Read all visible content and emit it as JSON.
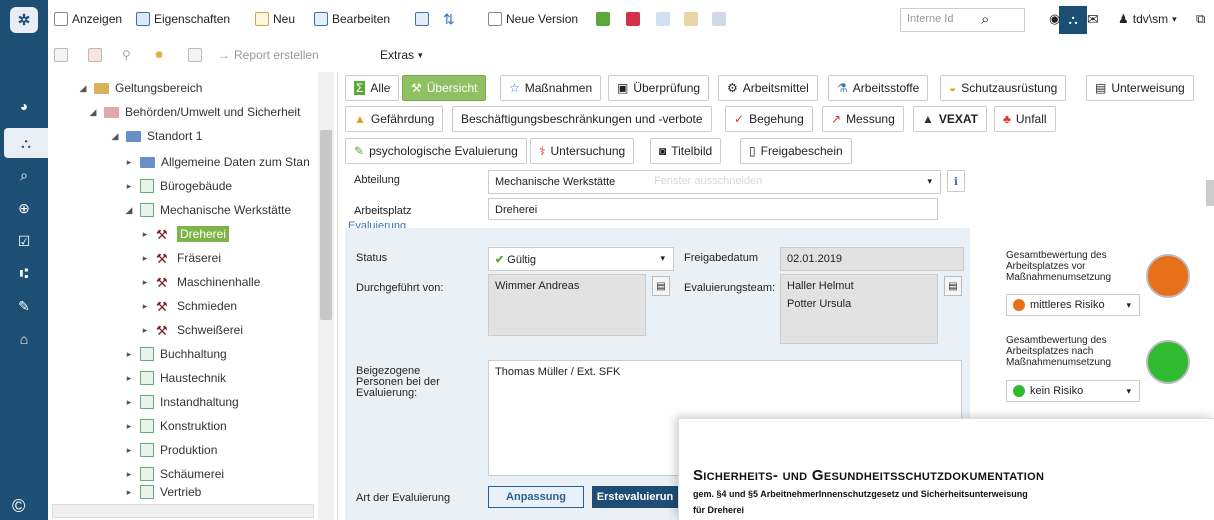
{
  "toolbar": {
    "anzeigen": "Anzeigen",
    "eigenschaften": "Eigenschaften",
    "neu": "Neu",
    "bearbeiten": "Bearbeiten",
    "neue_version": "Neue Version",
    "id_placeholder": "Interne Id",
    "user": "tdv\\sm",
    "report": "Report erstellen",
    "extras": "Extras"
  },
  "tree": [
    {
      "label": "Geltungsbereich"
    },
    {
      "label": "Behörden/Umwelt und Sicherheit"
    },
    {
      "label": "Standort 1"
    },
    {
      "label": "Allgemeine Daten zum Stan"
    },
    {
      "label": "Bürogebäude"
    },
    {
      "label": "Mechanische Werkstätte"
    },
    {
      "label": "Dreherei"
    },
    {
      "label": "Fräserei"
    },
    {
      "label": "Maschinenhalle"
    },
    {
      "label": "Schmieden"
    },
    {
      "label": "Schweißerei"
    },
    {
      "label": "Buchhaltung"
    },
    {
      "label": "Haustechnik"
    },
    {
      "label": "Instandhaltung"
    },
    {
      "label": "Konstruktion"
    },
    {
      "label": "Produktion"
    },
    {
      "label": "Schäumerei"
    },
    {
      "label": "Vertrieb"
    }
  ],
  "tabs": [
    {
      "label": "Alle"
    },
    {
      "label": "Übersicht"
    },
    {
      "label": "Maßnahmen"
    },
    {
      "label": "Überprüfung"
    },
    {
      "label": "Arbeitsmittel"
    },
    {
      "label": "Arbeitsstoffe"
    },
    {
      "label": "Schutzausrüstung"
    },
    {
      "label": "Unterweisung"
    },
    {
      "label": "Gefährdung"
    },
    {
      "label": "Beschäftigungsbeschränkungen und -verbote"
    },
    {
      "label": "Begehung"
    },
    {
      "label": "Messung"
    },
    {
      "label": "VEXAT"
    },
    {
      "label": "Unfall"
    },
    {
      "label": "psychologische Evaluierung"
    },
    {
      "label": "Untersuchung"
    },
    {
      "label": "Titelbild"
    },
    {
      "label": "Freigabeschein"
    }
  ],
  "form": {
    "abteilung_label": "Abteilung",
    "abteilung_value": "Mechanische Werkstätte",
    "abteilung_ghost": "Fenster ausschneiden",
    "arbeitsplatz_label": "Arbeitsplatz",
    "arbeitsplatz_value": "Dreherei",
    "section": "Evaluierung",
    "status_label": "Status",
    "status_value": "Gültig",
    "freigabedatum_label": "Freigabedatum",
    "freigabedatum_value": "02.01.2019",
    "durchgefuehrt_label": "Durchgeführt von:",
    "durchgefuehrt_value": "Wimmer Andreas",
    "team_label": "Evaluierungsteam:",
    "team_value_1": "Haller Helmut",
    "team_value_2": "Potter Ursula",
    "beigezogene_label_1": "Beigezogene",
    "beigezogene_label_2": "Personen bei der",
    "beigezogene_label_3": "Evaluierung:",
    "beigezogene_value": "Thomas Müller / Ext. SFK",
    "art_label": "Art der Evaluierung",
    "art_btn_1": "Anpassung",
    "art_btn_2": "Erstevaluierun"
  },
  "rating": {
    "before_line_1": "Gesamtbewertung des",
    "before_line_2": "Arbeitsplatzes vor",
    "before_line_3": "Maßnahmenumsetzung",
    "before_value": "mittleres Risiko",
    "before_color": "#e8701a",
    "after_line_1": "Gesamtbewertung des",
    "after_line_2": "Arbeitsplatzes nach",
    "after_line_3": "Maßnahmenumsetzung",
    "after_value": "kein Risiko",
    "after_color": "#2fba2f"
  },
  "doc": {
    "title": "Sicherheits- und Gesundheitsschutzdokumentation",
    "subtitle": "gem. §4 und §5 ArbeitnehmerInnenschutzgesetz und Sicherheitsunterweisung",
    "for": "für Dreherei"
  },
  "icons": {
    "search": "search-icon",
    "sitemap": "sitemap-icon",
    "eye": "eye-icon",
    "mail": "mail-icon",
    "user": "user-icon",
    "external": "external-link-icon"
  }
}
